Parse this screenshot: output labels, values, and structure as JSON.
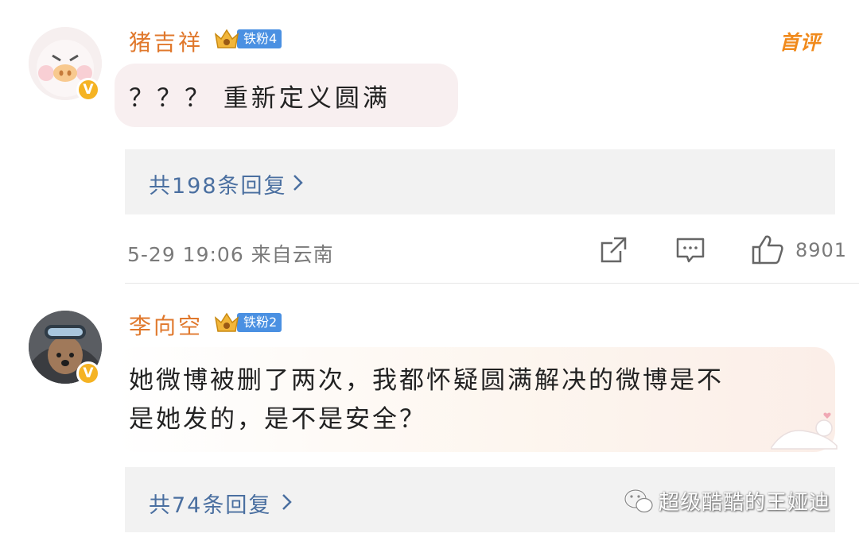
{
  "comments": [
    {
      "username": "猪吉祥",
      "fan_badge": "铁粉4",
      "first_badge": "首评",
      "text": "？？？ 重新定义圆满",
      "replies_label": "共198条回复",
      "timestamp": "5-29 19:06 来自云南",
      "likes": "8901"
    },
    {
      "username": "李向空",
      "fan_badge": "铁粉2",
      "text_line1": "她微博被删了两次，我都怀疑圆满解决的微博是不",
      "text_line2": "是她发的，是不是安全？",
      "replies_label": "共74条回复"
    }
  ],
  "verified_mark": "V",
  "watermark": "超级酷酷的王娅迪",
  "icons": [
    "share-icon",
    "comment-icon",
    "like-icon",
    "chevron-right-icon",
    "crown-icon",
    "wechat-icon"
  ]
}
